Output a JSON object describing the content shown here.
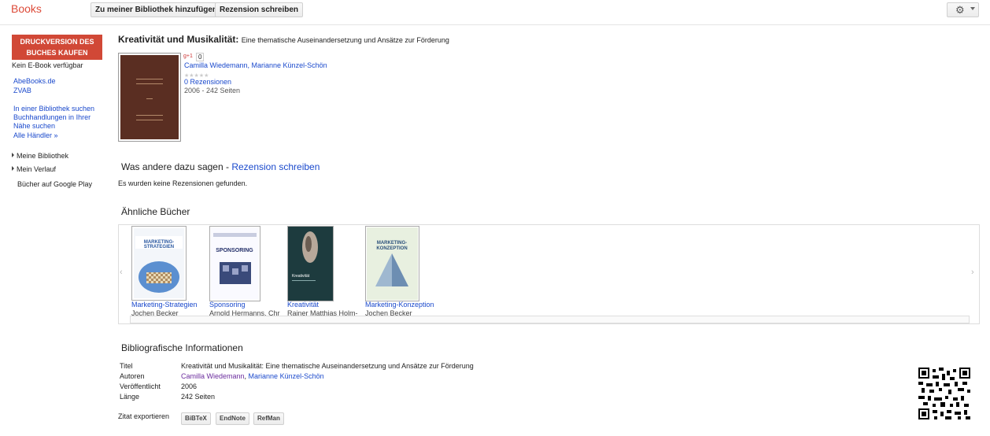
{
  "header": {
    "brand": "Books",
    "add_library": "Zu meiner Bibliothek hinzufügen",
    "write_review": "Rezension schreiben",
    "settings_icon": "gear-icon"
  },
  "sidebar": {
    "buy_line1": "DRUCKVERSION DES",
    "buy_line2": "BUCHES KAUFEN",
    "no_ebook": "Kein E-Book verfügbar",
    "stores": [
      "AbeBooks.de",
      "ZVAB"
    ],
    "library_line1": "In einer Bibliothek suchen",
    "shops_line1": "Buchhandlungen in Ihrer",
    "shops_line2": "Nähe suchen",
    "all_dealers": "Alle Händler »",
    "nav": [
      "Meine Bibliothek",
      "Mein Verlauf",
      "Bücher auf Google Play"
    ]
  },
  "book": {
    "title": "Kreativität und Musikalität:",
    "subtitle": "Eine thematische Auseinandersetzung und Ansätze zur Förderung",
    "gplus_count": "0",
    "authors": "Camilla Wiedemann, Marianne Künzel-Schön",
    "reviews": "0 Rezensionen",
    "meta": "2006 - 242 Seiten"
  },
  "reviews_section": {
    "heading": "Was andere dazu sagen -",
    "heading_link": "Rezension schreiben",
    "empty": "Es wurden keine Rezensionen gefunden."
  },
  "similar": {
    "heading": "Ähnliche Bücher",
    "prev": "‹",
    "next": "›",
    "items": [
      {
        "title": "Marketing-Strategien",
        "author": "Jochen Becker",
        "cover_text": "MARKETING-STRATEGIEN",
        "color": "#3b6fb0"
      },
      {
        "title": "Sponsoring",
        "author": "Arnold Hermanns, Chr",
        "cover_text": "SPONSORING",
        "color": "#3a4a7a"
      },
      {
        "title": "Kreativität",
        "author": "Rainer Matthias Holm-",
        "cover_text": "Kreativität",
        "color": "#1d3b3e"
      },
      {
        "title": "Marketing-Konzeption",
        "author": "Jochen Becker",
        "cover_text": "MARKETING-KONZEPTION",
        "color": "#4d7aa8"
      }
    ]
  },
  "biblio": {
    "heading": "Bibliografische Informationen",
    "labels": [
      "Titel",
      "Autoren",
      "Veröffentlicht",
      "Länge"
    ],
    "title": "Kreativität und Musikalität: Eine thematische Auseinandersetzung und Ansätze zur Förderung",
    "author1": "Camilla Wiedemann",
    "author2": "Marianne Künzel-Schön",
    "published": "2006",
    "length": "242 Seiten",
    "export_label": "Zitat exportieren",
    "export_buttons": [
      "BiBTeX",
      "EndNote",
      "RefMan"
    ]
  }
}
